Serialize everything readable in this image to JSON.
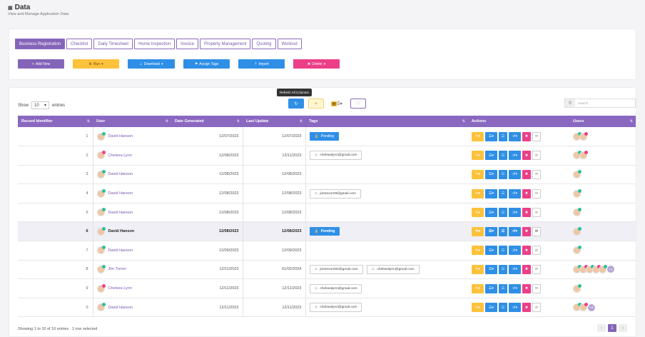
{
  "header": {
    "title": "Data",
    "subtitle": "View and Manage Application Data"
  },
  "tabs": [
    "Business Registration",
    "Checklist",
    "Daily Timesheet",
    "Home Inspection",
    "Invoice",
    "Property Management",
    "Quoting",
    "Workout"
  ],
  "actions": {
    "add": "Add New",
    "run": "Run",
    "download": "Download",
    "assign": "Assign Tags",
    "import": "Import",
    "delete": "Delete"
  },
  "colors": {
    "purple": "#8464b8",
    "yellow": "#fcc23c",
    "blue": "#2f8fe6",
    "pink": "#ec3f88"
  },
  "table_controls": {
    "show_label": "Show",
    "page_size": "10",
    "entries_label": "entries",
    "tooltip": "Refresh All Columns",
    "search_placeholder": "Search"
  },
  "columns": [
    "Record Identifier",
    "User",
    "Date Generated",
    "Last Update",
    "Tags",
    "Actions",
    "Users"
  ],
  "rows": [
    {
      "id": "1",
      "user": "David Hanson",
      "generated": "12/07/2023",
      "updated": "12/07/2023",
      "tags": [
        {
          "type": "pending",
          "label": "Pending"
        }
      ],
      "users": 2,
      "more": ""
    },
    {
      "id": "2",
      "user": "Chelsea Lynn",
      "generated": "12/08/2023",
      "updated": "12/11/2023",
      "tags": [
        {
          "type": "email",
          "label": "chelsealynn@gmail.com"
        }
      ],
      "users": 2,
      "more": ""
    },
    {
      "id": "3",
      "user": "David Hanson",
      "generated": "12/08/2023",
      "updated": "12/08/2023",
      "tags": [],
      "users": 1,
      "more": ""
    },
    {
      "id": "4",
      "user": "David Hanson",
      "generated": "12/08/2023",
      "updated": "12/08/2023",
      "tags": [
        {
          "type": "email",
          "label": "jimtrevor29@gmail.com"
        }
      ],
      "users": 1,
      "more": ""
    },
    {
      "id": "5",
      "user": "David Hanson",
      "generated": "12/08/2023",
      "updated": "12/08/2023",
      "tags": [],
      "users": 1,
      "more": ""
    },
    {
      "id": "6",
      "user": "David Hanson",
      "generated": "12/08/2023",
      "updated": "12/08/2023",
      "tags": [
        {
          "type": "pending",
          "label": "Pending"
        }
      ],
      "users": 1,
      "more": ""
    },
    {
      "id": "7",
      "user": "David Hanson",
      "generated": "12/09/2023",
      "updated": "12/09/2023",
      "tags": [],
      "users": 1,
      "more": ""
    },
    {
      "id": "8",
      "user": "Jim Trevor",
      "generated": "12/11/2023",
      "updated": "01/02/2024",
      "tags": [
        {
          "type": "email",
          "label": "jimtrevor292@gmail.com"
        },
        {
          "type": "email",
          "label": "chelsealynn@gmail.com"
        }
      ],
      "users": 5,
      "more": "+1"
    },
    {
      "id": "9",
      "user": "Chelsea Lynn",
      "generated": "12/11/2023",
      "updated": "12/11/2023",
      "tags": [
        {
          "type": "email",
          "label": "chelsealynn@gmail.com"
        }
      ],
      "users": 1,
      "more": ""
    },
    {
      "id": "0",
      "user": "David Hanson",
      "generated": "12/11/2023",
      "updated": "12/11/2023",
      "tags": [
        {
          "type": "email",
          "label": "chelsealynn@gmail.com"
        }
      ],
      "users": 2,
      "more": "+1"
    }
  ],
  "highlight_row": "6",
  "footer": {
    "info": "Showing 1 to 10 of 10 entries",
    "selected": "1 row selected",
    "page": "1"
  }
}
